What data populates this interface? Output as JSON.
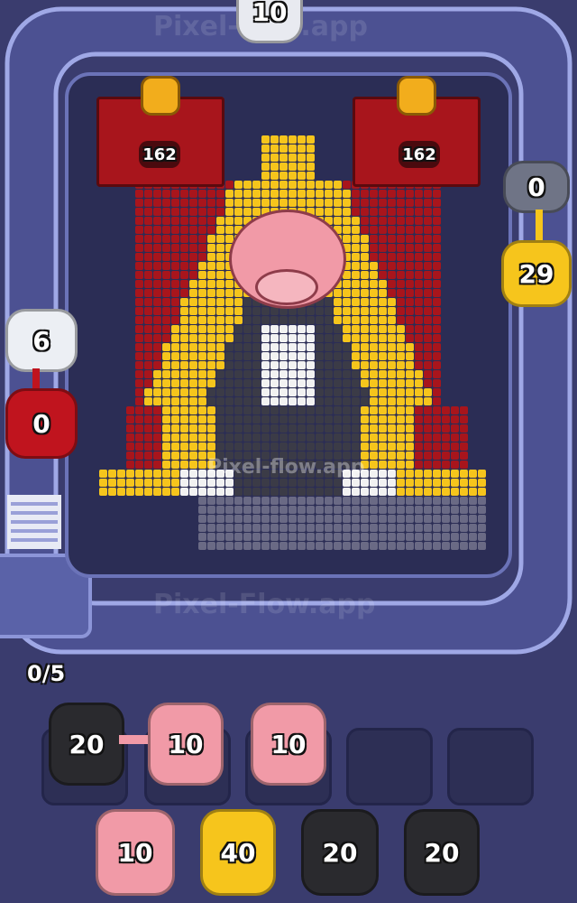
{
  "watermarks": {
    "top": "Pixel-flow.app",
    "center": "Pixel-flow.app",
    "bottom": "Pixel-Flow.app"
  },
  "top_shooter": {
    "value": "10",
    "color": "#e8eaf0"
  },
  "right_shooters": [
    {
      "value": "0",
      "color": "#6f7486"
    },
    {
      "value": "29",
      "color": "#f6c51c"
    }
  ],
  "left_shooters": [
    {
      "value": "6",
      "color": "#eceff4"
    },
    {
      "value": "0",
      "color": "#c0141e"
    }
  ],
  "chests": [
    {
      "value": "162",
      "icon": "key-icon"
    },
    {
      "value": "162",
      "icon": "key-icon"
    }
  ],
  "queue_progress": "0/5",
  "queue_slots": [
    {
      "value": "20",
      "color": "#2a2a2e"
    },
    {
      "value": "10",
      "color": "#f19aa7"
    },
    {
      "value": "10",
      "color": "#f19aa7"
    },
    {
      "value": "",
      "color": ""
    },
    {
      "value": "",
      "color": ""
    }
  ],
  "reserve": [
    {
      "value": "10",
      "color": "#f19aa7"
    },
    {
      "value": "40",
      "color": "#f6c51c"
    },
    {
      "value": "20",
      "color": "#2a2a2e"
    },
    {
      "value": "20",
      "color": "#2a2a2e"
    }
  ],
  "colors": {
    "red": "#a8151c",
    "yellow": "#f6c51c",
    "dark": "#3b3b47",
    "white": "#f2f2f2",
    "pink": "#f19aa7",
    "grey": "#6a6a85"
  }
}
